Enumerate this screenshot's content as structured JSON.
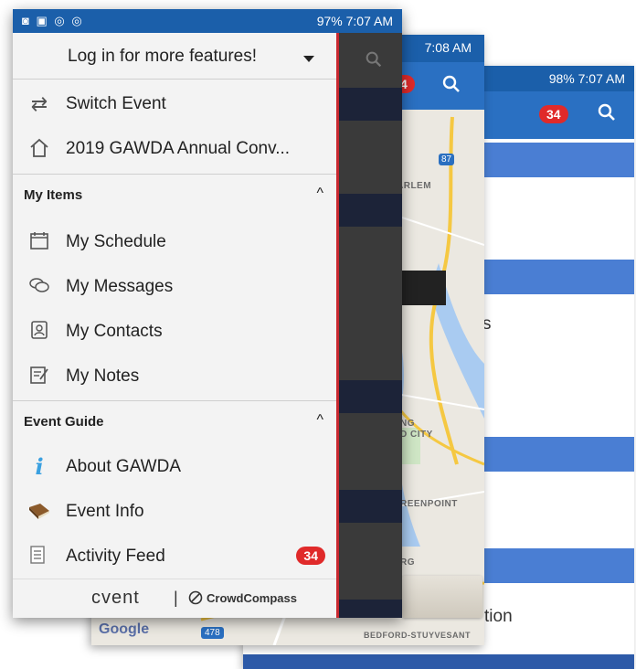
{
  "back_screen": {
    "status_text": "98% 7:07 AM",
    "badge_count": "34",
    "labels": [
      "s",
      "tion"
    ]
  },
  "middle_screen": {
    "status_time": "7:08 AM",
    "badge_count": "4",
    "map_labels": [
      "ARLEM",
      "NG",
      "D CITY",
      "REENPOINT",
      "RG",
      "BEDFORD-STUYVESANT"
    ],
    "google_label": "Google",
    "highway_label": "478",
    "route_label": "87"
  },
  "front_screen": {
    "status_right": "97% 7:07 AM",
    "login_text": "Log in for more features!",
    "switch_event": "Switch Event",
    "event_name": "2019 GAWDA Annual Conv...",
    "sections": [
      {
        "title": "My Items",
        "items": [
          {
            "label": "My Schedule",
            "icon": "calendar-icon"
          },
          {
            "label": "My Messages",
            "icon": "chat-icon"
          },
          {
            "label": "My Contacts",
            "icon": "contacts-icon"
          },
          {
            "label": "My Notes",
            "icon": "notes-icon"
          }
        ]
      },
      {
        "title": "Event Guide",
        "items": [
          {
            "label": "About GAWDA",
            "icon": "info-icon"
          },
          {
            "label": "Event Info",
            "icon": "book-icon"
          },
          {
            "label": "Activity Feed",
            "icon": "feed-icon",
            "badge": "34"
          }
        ]
      }
    ],
    "footer": {
      "left": "cvent",
      "right": "CrowdCompass"
    }
  },
  "colors": {
    "blue_dark": "#1b5faa",
    "blue": "#2a70c2",
    "badge_red": "#e02a2a",
    "drawer_bg": "#f3f3f3"
  }
}
